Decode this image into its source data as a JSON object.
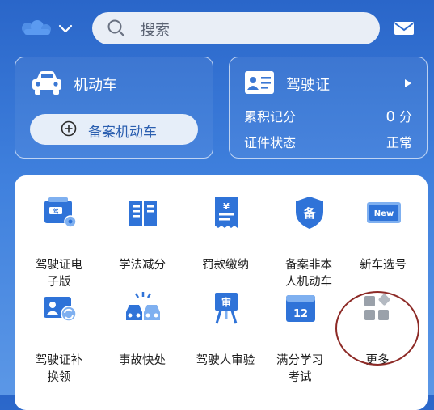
{
  "header": {
    "search_placeholder": "搜索",
    "icons": [
      "app-logo-icon",
      "chevron-down-icon",
      "search-icon",
      "mail-icon"
    ]
  },
  "vehicle_card": {
    "title": "机动车",
    "add_button_label": "备案机动车"
  },
  "license_card": {
    "title": "驾驶证",
    "points_label": "累积记分",
    "points_value": "0",
    "points_unit": "分",
    "status_label": "证件状态",
    "status_value": "正常"
  },
  "services": [
    {
      "label": "驾驶证电子版",
      "icon": "e-license-icon"
    },
    {
      "label": "学法减分",
      "icon": "book-icon"
    },
    {
      "label": "罚款缴纳",
      "icon": "fine-receipt-icon"
    },
    {
      "label": "备案非本人机动车",
      "icon": "shield-record-icon"
    },
    {
      "label": "新车选号",
      "icon": "new-plate-icon"
    },
    {
      "label": "驾驶证补换领",
      "icon": "license-renew-icon"
    },
    {
      "label": "事故快处",
      "icon": "accident-icon"
    },
    {
      "label": "驾驶人审验",
      "icon": "driver-review-icon"
    },
    {
      "label": "满分学习考试",
      "icon": "calendar-exam-icon"
    },
    {
      "label": "更多",
      "icon": "more-apps-icon"
    }
  ],
  "colors": {
    "header_blue": "#2a66c9",
    "icon_blue": "#2f73d8",
    "highlight_circle": "#8d2a26"
  }
}
